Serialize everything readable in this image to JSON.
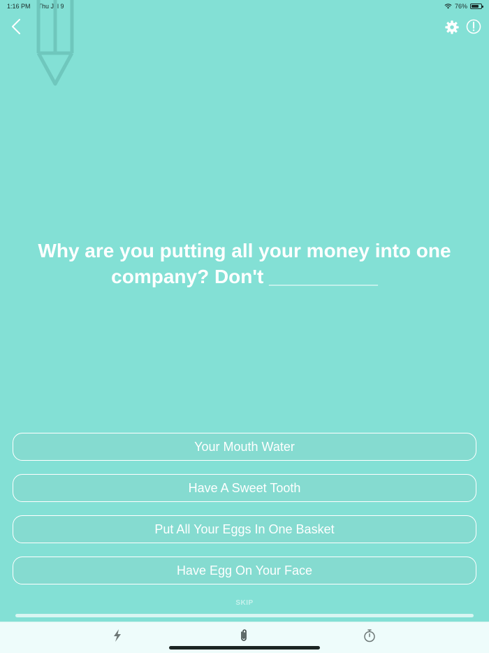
{
  "status_bar": {
    "time": "1:16 PM",
    "date": "Thu Jul 9",
    "battery_text": "76%",
    "battery_level": 0.76,
    "wifi_icon": "wifi-icon",
    "battery_icon": "battery-icon"
  },
  "header": {
    "back_icon": "chevron-left-icon",
    "decor_icon": "pencil-icon",
    "settings_icon": "gear-icon",
    "report_icon": "exclamation-circle-icon"
  },
  "question": {
    "text": "Why are you putting all your money into one company? Don't __________"
  },
  "answers": [
    {
      "label": "Your Mouth Water"
    },
    {
      "label": "Have A Sweet Tooth"
    },
    {
      "label": "Put All Your Eggs In One Basket"
    },
    {
      "label": "Have Egg On Your Face"
    }
  ],
  "skip_label": "SKIP",
  "progress": {
    "value": 1.0
  },
  "tab_bar": {
    "items": [
      {
        "icon": "lightning-icon"
      },
      {
        "icon": "paperclip-icon"
      },
      {
        "icon": "stopwatch-icon"
      }
    ]
  },
  "colors": {
    "background": "#83e0d5",
    "text": "#ffffff",
    "tab_bar_background": "#eefcfb",
    "icon_gray": "#6e7877"
  }
}
